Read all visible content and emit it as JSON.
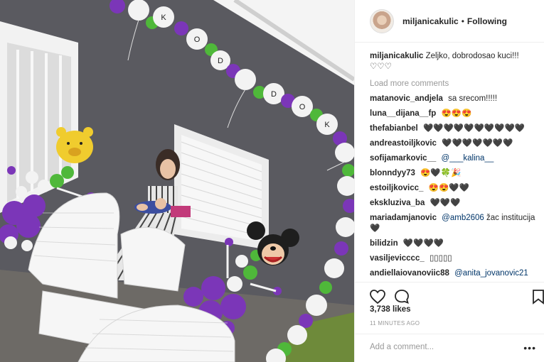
{
  "post": {
    "username": "miljanicakulic",
    "dot": "•",
    "follow_status": "Following",
    "caption_user": "miljanicakulic",
    "caption_text": "Zeljko, dobrodosao kuci!!! ♡♡♡",
    "load_more": "Load more comments",
    "likes": "3,738 likes",
    "time": "11 MINUTES AGO",
    "add_comment_placeholder": "Add a comment..."
  },
  "comments": [
    {
      "user": "matanovic_andjela",
      "text": "sa srecom!!!!!",
      "mention": ""
    },
    {
      "user": "luna__dijana__fp",
      "text": "😍😍😍",
      "mention": ""
    },
    {
      "user": "thefabianbel",
      "text": "🖤🖤🖤🖤🖤🖤🖤🖤🖤🖤",
      "mention": ""
    },
    {
      "user": "andreastoiljkovic",
      "text": "🖤🖤🖤🖤🖤🖤🖤",
      "mention": ""
    },
    {
      "user": "sofijamarkovic__",
      "text": "",
      "mention": "@___kalina__"
    },
    {
      "user": "blonndyy73",
      "text": "😍🖤🍀🎉",
      "mention": ""
    },
    {
      "user": "estoiljkovicc_",
      "text": "😍😍🖤🖤",
      "mention": ""
    },
    {
      "user": "ekskluziva_ba",
      "text": "🖤🖤🖤",
      "mention": ""
    },
    {
      "user": "mariadamjanovic",
      "text": "žac institucija🖤",
      "mention": "@amb2606"
    },
    {
      "user": "bilidzin",
      "text": "🖤🖤🖤🖤",
      "mention": ""
    },
    {
      "user": "vasiljevicccc_",
      "text": "▯▯▯▯▯",
      "mention": ""
    },
    {
      "user": "andiellaiovanoviic88",
      "text": "",
      "mention": "@anita_jovanovic21"
    }
  ],
  "photo": {
    "balloon_letters": [
      "K",
      "O",
      "D",
      "D",
      "O",
      "K"
    ],
    "colors": {
      "wall": "#5a5a60",
      "purple": "#7b36b8",
      "green": "#4fb83a",
      "white": "#f3f3f3"
    }
  },
  "icons": {
    "like": "heart-icon",
    "comment": "speech-bubble-icon",
    "save": "bookmark-icon",
    "more": "ellipsis-icon"
  }
}
